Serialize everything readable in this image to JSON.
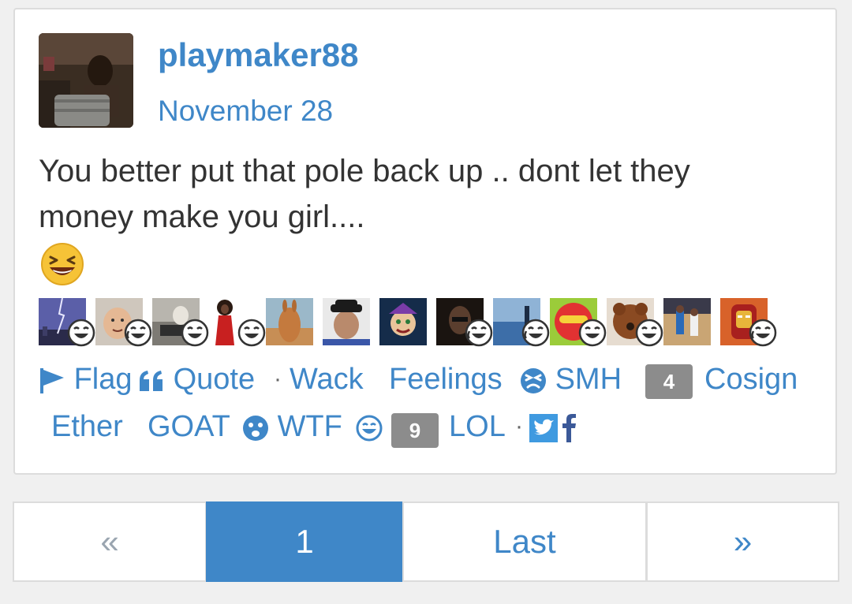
{
  "post": {
    "username": "playmaker88",
    "date": "November 28",
    "body_line1": "You better put that pole back up .. dont let they",
    "body_line2": "money make you girl....",
    "emoji_icon": "laughing-face-icon"
  },
  "reactors": [
    {
      "thumb": "lightning-city",
      "reaction": "laugh"
    },
    {
      "thumb": "baby-face",
      "reaction": "laugh-cry"
    },
    {
      "thumb": "people-car",
      "reaction": "laugh"
    },
    {
      "thumb": "red-dress-woman",
      "reaction": "laugh"
    },
    {
      "thumb": "kangaroo",
      "reaction": "none"
    },
    {
      "thumb": "man-hat",
      "reaction": "none"
    },
    {
      "thumb": "jester-cartoon",
      "reaction": "none"
    },
    {
      "thumb": "dark-portrait",
      "reaction": "laugh-cry"
    },
    {
      "thumb": "beach-scene",
      "reaction": "laugh-cry"
    },
    {
      "thumb": "red-sunglasses",
      "reaction": "love-laugh"
    },
    {
      "thumb": "teddy-dog",
      "reaction": "laugh"
    },
    {
      "thumb": "basketball-players",
      "reaction": "none"
    },
    {
      "thumb": "iron-man",
      "reaction": "laugh-cry"
    }
  ],
  "actions": {
    "flag": "Flag",
    "quote": "Quote",
    "sep": "·",
    "wack": "Wack",
    "feelings": "Feelings",
    "smh": "SMH",
    "cosign_count": "4",
    "cosign": "Cosign",
    "ether": "Ether",
    "goat": "GOAT",
    "wtf": "WTF",
    "lol_count": "9",
    "lol": "LOL",
    "twitter_icon": "twitter-icon",
    "facebook_icon": "facebook-icon"
  },
  "pagination": {
    "prev": "«",
    "current": "1",
    "last": "Last",
    "next": "»"
  },
  "colors": {
    "accent": "#3f87c8",
    "badge": "#8c8c8c",
    "text": "#333333",
    "border": "#dcdcdc"
  }
}
